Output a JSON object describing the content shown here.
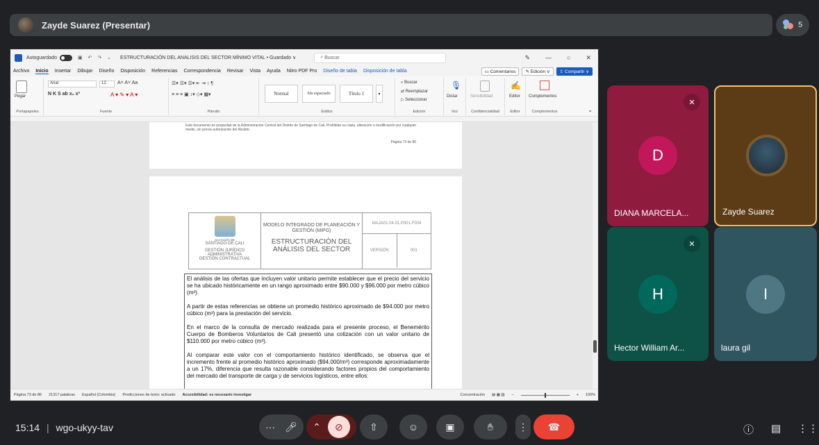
{
  "presenter": {
    "name": "Zayde Suarez (Presentar)"
  },
  "participants_count": "5",
  "word": {
    "autosave_label": "Autoguardado",
    "doc_title": "ESTRUCTURACIÓN DEL ANALISIS DEL SECTOR MÍNIMO VITAL • Guardado ∨",
    "search_placeholder": "Buscar",
    "menu": [
      "Archivo",
      "Inicio",
      "Insertar",
      "Dibujar",
      "Diseño",
      "Disposición",
      "Referencias",
      "Correspondencia",
      "Revisar",
      "Vista",
      "Ayuda",
      "Nitro PDF Pro",
      "Diseño de tabla",
      "Disposición de tabla"
    ],
    "comments_btn": "Comentarios",
    "edit_btn": "Edición ∨",
    "share_btn": "Compartir ∨",
    "ribbon": {
      "paste": "Pegar",
      "font_name": "Arial",
      "font_size": "12",
      "styles": [
        "Normal",
        "Sin espaciado",
        "Título 1"
      ],
      "find": "Buscar",
      "replace": "Reemplazar",
      "select": "Seleccionar",
      "dictate": "Dictar",
      "sensitivity": "Sensibilidad",
      "editor": "Editor",
      "addins": "Complementos",
      "groups": [
        "Portapapeles",
        "Fuente",
        "Párrafo",
        "Estilos",
        "Edición",
        "Voz",
        "Confidencialidad",
        "Editor",
        "Complementos"
      ]
    },
    "page1_note": "Este documento es propiedad de la Administración Central del Distrito de Santiago de Cali. Prohibida su copia, alteración o modificación por cualquier medio, sin previa autorización del Alcalde.",
    "page1_page": "Página 73 de 86",
    "header": {
      "org1": "ALCALDÍA DE",
      "org2": "SANTIAGO DE CALI",
      "dept1": "GESTIÓN JURÍDICO",
      "dept2": "ADMINISTRATIVA",
      "dept3": "GESTIÓN CONTRACTUAL",
      "model": "MODELO INTEGRADO DE PLANEACIÓN Y GESTIÓN (MIPG)",
      "title": "ESTRUCTURACIÓN DEL ANÁLISIS DEL SECTOR",
      "code": "MAJA01.04.01.P001.F004",
      "version_label": "VERSIÓN",
      "version": "001"
    },
    "paragraphs": [
      "El análisis de las ofertas que incluyen valor unitario permite establecer que el precio del servicio se ha ubicado históricamente en un rango aproximado entre $90.000 y $96.000 por metro cúbico (m³).",
      "A partir de estas referencias se obtiene un promedio histórico aproximado de $94.000 por metro cúbico (m³) para la prestación del servicio.",
      "En el marco de la consulta de mercado realizada para el presente proceso, el Benemérito Cuerpo de Bomberos Voluntarios de Cali presentó una cotización con un valor unitario de $110.000 por metro cúbico (m³).",
      "Al comparar este valor con el comportamiento histórico identificado, se observa que el incremento frente al promedio histórico aproximado ($94.000/m³) corresponde aproximadamente a un 17%, diferencia que resulta razonable considerando factores propios del comportamiento del mercado del transporte de carga y de servicios logísticos, entre ellos:"
    ],
    "status": {
      "page": "Página 73 de 86",
      "words": "21317 palabras",
      "lang": "Español (Colombia)",
      "predict": "Predicciones de texto: activado",
      "access": "Accesibilidad: es necesario investigar",
      "focus": "Concentración",
      "zoom": "100%"
    }
  },
  "tiles": [
    {
      "name": "DIANA MARCELA...",
      "initial": "D",
      "muted": true
    },
    {
      "name": "Zayde Suarez",
      "initial": "",
      "muted": false
    },
    {
      "name": "Hector William Ar...",
      "initial": "H",
      "muted": true
    },
    {
      "name": "laura gil",
      "initial": "I",
      "muted": false
    }
  ],
  "meeting": {
    "time": "15:14",
    "separator": "|",
    "code": "wgo-ukyy-tav"
  },
  "colors": {
    "accent_red": "#ea4335",
    "tile_pink": "#8f1b3f",
    "tile_teal": "#0e5146",
    "tile_brown": "#5c3b17",
    "tile_slate": "#2f5560"
  }
}
